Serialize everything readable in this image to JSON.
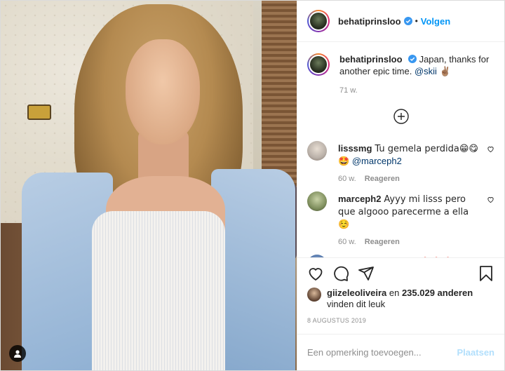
{
  "header": {
    "username": "behatiprinsloo",
    "separator": "•",
    "follow_label": "Volgen"
  },
  "caption": {
    "username": "behatiprinsloo",
    "text": "Japan, thanks for another epic time.",
    "mention": "@skii",
    "emoji": "✌🏽",
    "time": "71 w."
  },
  "load_more_icon": "plus-circle-icon",
  "comments": [
    {
      "username": "lisssmg",
      "text": "Tu gemela perdida😁😋",
      "text2": "🤩",
      "mention": "@marceph2",
      "time": "60 w.",
      "reply": "Reageren",
      "avatar_color": "#b9b0a8"
    },
    {
      "username": "marceph2",
      "text": "Ayyy mi lisss pero que algooo parecerme a ella☺️",
      "time": "60 w.",
      "reply": "Reageren",
      "avatar_color": "#7f8f5e"
    },
    {
      "username": "miss_arianna_bay",
      "text": "🔥🔥🔥",
      "avatar_color": "#4a6fa5"
    }
  ],
  "actions": {
    "like_icon": "heart-icon",
    "comment_icon": "comment-icon",
    "share_icon": "share-icon",
    "save_icon": "bookmark-icon"
  },
  "likes": {
    "liker": "giizeleoliveira",
    "middle": " en ",
    "count": "235.029 anderen",
    "suffix": "vinden dit leuk"
  },
  "date": "8 AUGUSTUS 2019",
  "add_comment": {
    "placeholder": "Een opmerking toevoegen...",
    "post_label": "Plaatsen"
  },
  "colors": {
    "link": "#0095f6",
    "mention": "#00376b",
    "muted": "#8e8e8e",
    "disabled_post": "#b2dffc"
  }
}
